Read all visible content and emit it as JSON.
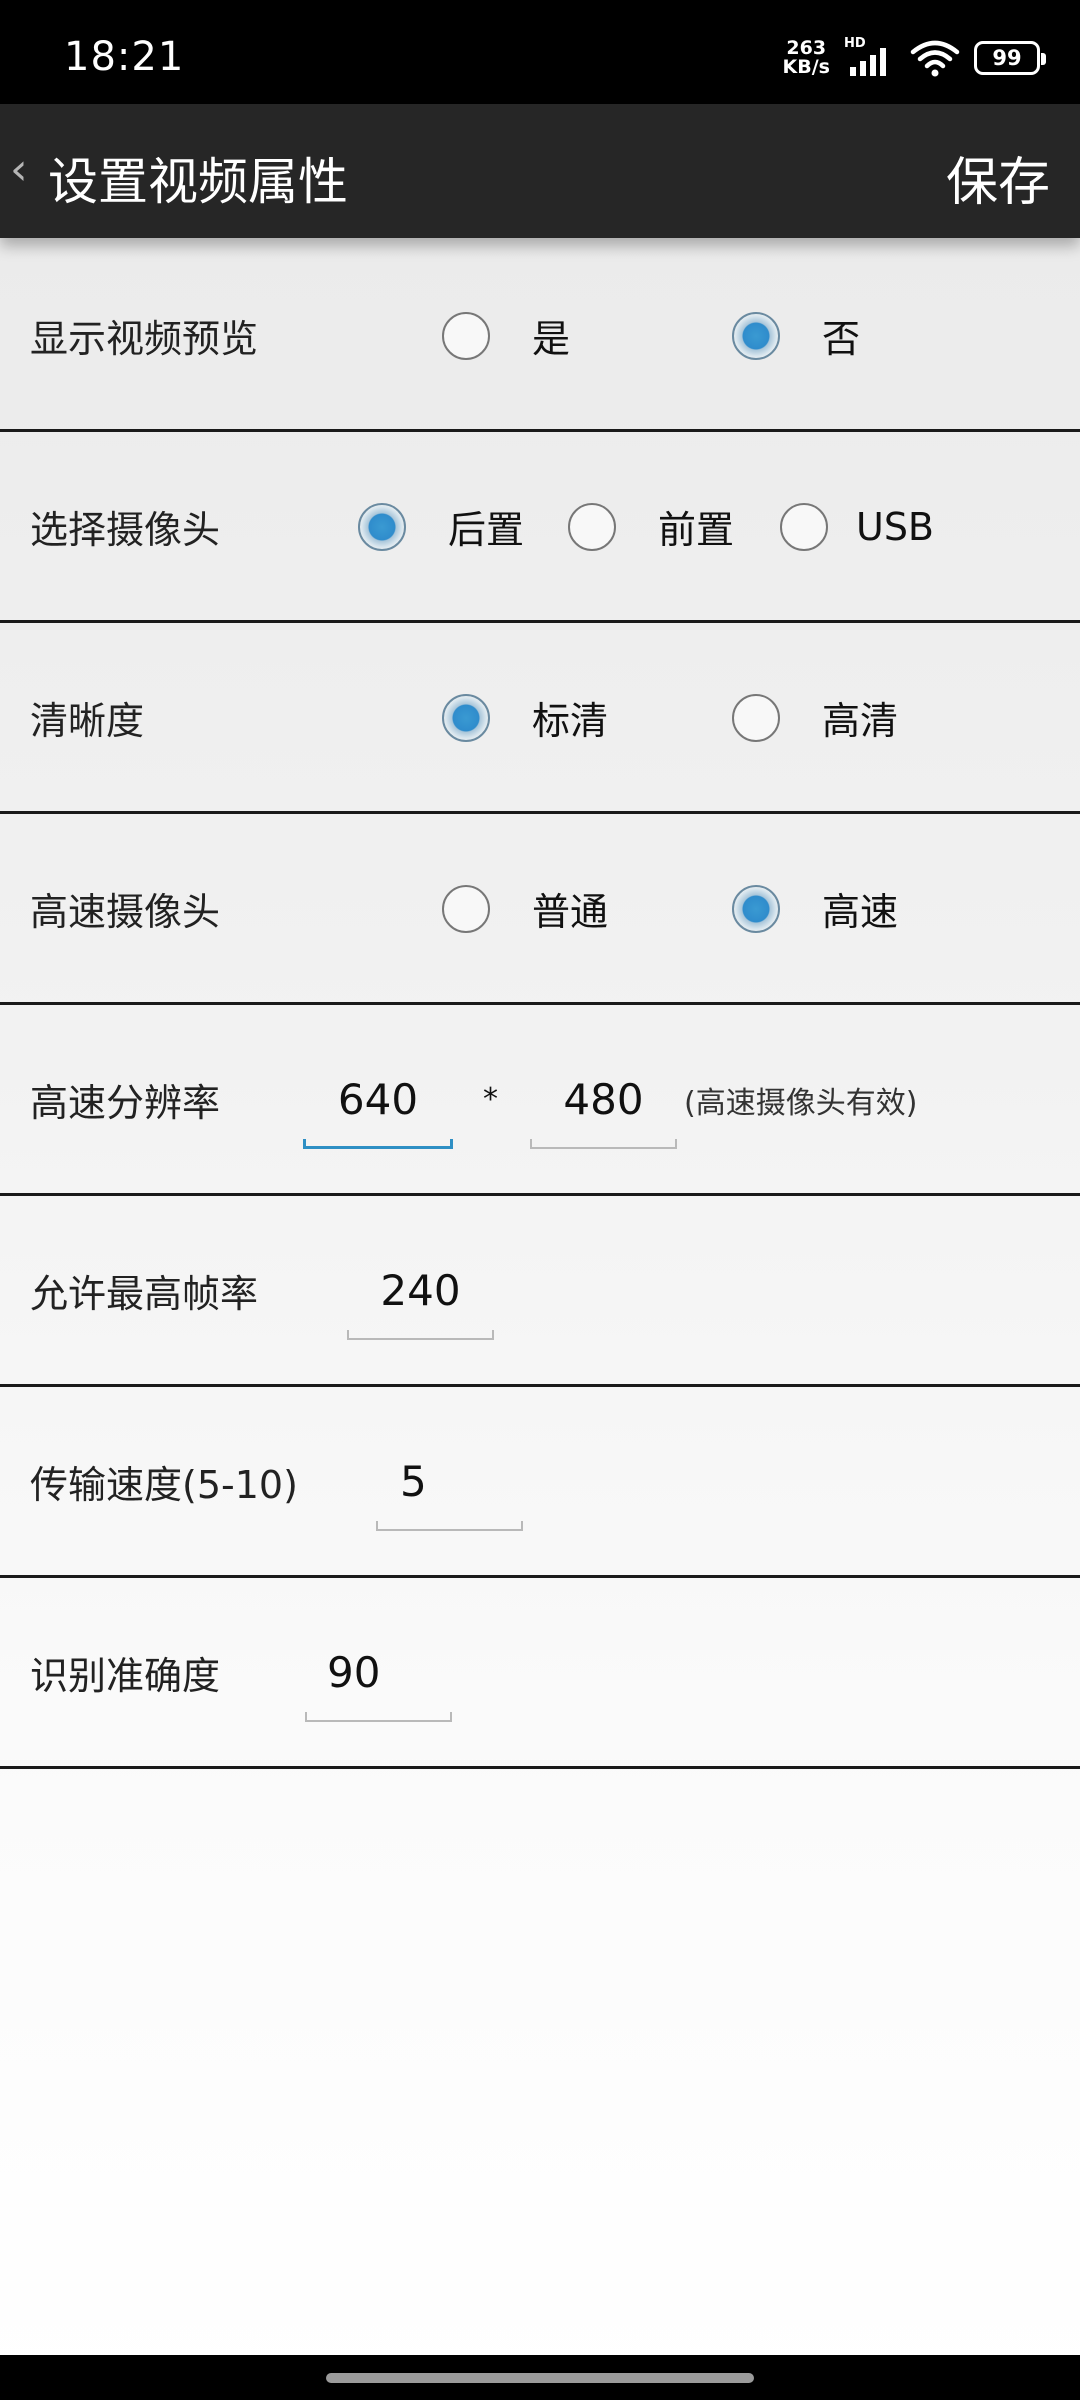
{
  "status_bar": {
    "time": "18:21",
    "net_speed_value": "263",
    "net_speed_unit": "KB/s",
    "network_label": "HD",
    "battery": "99"
  },
  "header": {
    "back_icon": "‹",
    "title": "设置视频属性",
    "save_label": "保存"
  },
  "settings": {
    "preview": {
      "label": "显示视频预览",
      "options": [
        "是",
        "否"
      ],
      "selected": "否"
    },
    "camera": {
      "label": "选择摄像头",
      "options": [
        "后置",
        "前置",
        "USB"
      ],
      "selected": "后置"
    },
    "clarity": {
      "label": "清晰度",
      "options": [
        "标清",
        "高清"
      ],
      "selected": "标清"
    },
    "speed_camera": {
      "label": "高速摄像头",
      "options": [
        "普通",
        "高速"
      ],
      "selected": "高速"
    },
    "resolution": {
      "label": "高速分辨率",
      "width": "640",
      "separator": "*",
      "height": "480",
      "hint": "(高速摄像头有效)"
    },
    "max_fps": {
      "label": "允许最高帧率",
      "value": "240"
    },
    "transfer_speed": {
      "label": "传输速度(5-10)",
      "value": "5"
    },
    "accuracy": {
      "label": "识别准确度",
      "value": "90"
    }
  },
  "colors": {
    "accent": "#2e8fc4",
    "action_bar": "#262626",
    "divider": "#1a1a1a"
  }
}
